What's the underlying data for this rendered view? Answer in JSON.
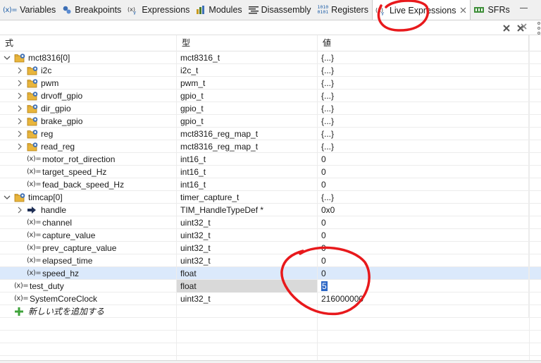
{
  "tabs": [
    {
      "icon": "variables-icon",
      "label": "Variables"
    },
    {
      "icon": "breakpoints-icon",
      "label": "Breakpoints"
    },
    {
      "icon": "expressions-icon",
      "label": "Expressions"
    },
    {
      "icon": "modules-icon",
      "label": "Modules"
    },
    {
      "icon": "disassembly-icon",
      "label": "Disassembly"
    },
    {
      "icon": "registers-icon",
      "label": "Registers"
    },
    {
      "icon": "live-expressions-icon",
      "label": "Live Expressions",
      "active": true
    },
    {
      "icon": "sfrs-icon",
      "label": "SFRs"
    }
  ],
  "icon_glyphs": {
    "variables": "(x)=",
    "registers": "1010\n0101"
  },
  "columns": {
    "expression": "式",
    "type": "型",
    "value": "値"
  },
  "rows": [
    {
      "indent": 0,
      "twisty": "open",
      "icon": "struct-folder-icon",
      "name": "mct8316[0]",
      "type": "mct8316_t",
      "value": "{...}"
    },
    {
      "indent": 1,
      "twisty": "closed",
      "icon": "struct-folder-icon",
      "name": "i2c",
      "type": "i2c_t",
      "value": "{...}"
    },
    {
      "indent": 1,
      "twisty": "closed",
      "icon": "struct-folder-icon",
      "name": "pwm",
      "type": "pwm_t",
      "value": "{...}"
    },
    {
      "indent": 1,
      "twisty": "closed",
      "icon": "struct-folder-icon",
      "name": "drvoff_gpio",
      "type": "gpio_t",
      "value": "{...}"
    },
    {
      "indent": 1,
      "twisty": "closed",
      "icon": "struct-folder-icon",
      "name": "dir_gpio",
      "type": "gpio_t",
      "value": "{...}"
    },
    {
      "indent": 1,
      "twisty": "closed",
      "icon": "struct-folder-icon",
      "name": "brake_gpio",
      "type": "gpio_t",
      "value": "{...}"
    },
    {
      "indent": 1,
      "twisty": "closed",
      "icon": "struct-folder-icon",
      "name": "reg",
      "type": "mct8316_reg_map_t",
      "value": "{...}"
    },
    {
      "indent": 1,
      "twisty": "closed",
      "icon": "struct-folder-icon",
      "name": "read_reg",
      "type": "mct8316_reg_map_t",
      "value": "{...}"
    },
    {
      "indent": 1,
      "twisty": "none",
      "icon": "variable-icon",
      "name": "motor_rot_direction",
      "type": "int16_t",
      "value": "0"
    },
    {
      "indent": 1,
      "twisty": "none",
      "icon": "variable-icon",
      "name": "target_speed_Hz",
      "type": "int16_t",
      "value": "0"
    },
    {
      "indent": 1,
      "twisty": "none",
      "icon": "variable-icon",
      "name": "fead_back_speed_Hz",
      "type": "int16_t",
      "value": "0"
    },
    {
      "indent": 0,
      "twisty": "open",
      "icon": "struct-folder-icon",
      "name": "timcap[0]",
      "type": "timer_capture_t",
      "value": "{...}"
    },
    {
      "indent": 1,
      "twisty": "closed",
      "icon": "pointer-arrow-icon",
      "name": "handle",
      "type": "TIM_HandleTypeDef *",
      "value": "0x0"
    },
    {
      "indent": 1,
      "twisty": "none",
      "icon": "variable-icon",
      "name": "channel",
      "type": "uint32_t",
      "value": "0"
    },
    {
      "indent": 1,
      "twisty": "none",
      "icon": "variable-icon",
      "name": "capture_value",
      "type": "uint32_t",
      "value": "0"
    },
    {
      "indent": 1,
      "twisty": "none",
      "icon": "variable-icon",
      "name": "prev_capture_value",
      "type": "uint32_t",
      "value": "0"
    },
    {
      "indent": 1,
      "twisty": "none",
      "icon": "variable-icon",
      "name": "elapsed_time",
      "type": "uint32_t",
      "value": "0"
    },
    {
      "indent": 1,
      "twisty": "none",
      "icon": "variable-icon",
      "name": "speed_hz",
      "type": "float",
      "value": "0",
      "highlight": "blue"
    },
    {
      "indent": -1,
      "twisty": "none",
      "icon": "variable-icon",
      "name": "test_duty",
      "type": "float",
      "value": "5",
      "highlight": "gray",
      "editing": true
    },
    {
      "indent": -1,
      "twisty": "none",
      "icon": "variable-icon",
      "name": "SystemCoreClock",
      "type": "uint32_t",
      "value": "216000000"
    },
    {
      "indent": -1,
      "twisty": "none",
      "icon": "add-plus-icon",
      "name": "新しい式を追加する",
      "type": "",
      "value": "",
      "italic": true
    }
  ],
  "colors": {
    "accent": "#2c67c6",
    "selection": "#dbe9fb",
    "annotation": "#e8191c"
  }
}
